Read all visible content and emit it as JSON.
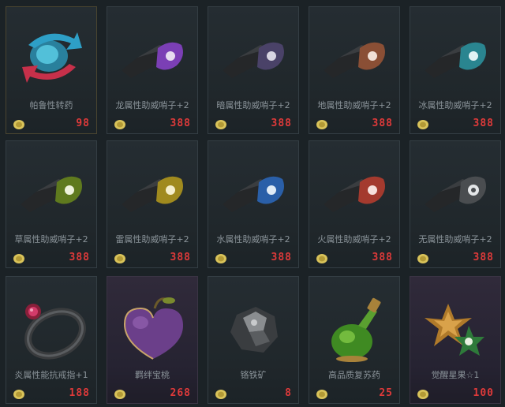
{
  "items": [
    {
      "name": "帕鲁性转药",
      "price": "98",
      "icon": "gender-swap-potion-icon"
    },
    {
      "name": "龙属性助威哨子+2",
      "price": "388",
      "icon": "dragon-whistle-icon",
      "color": "#7b3fb5"
    },
    {
      "name": "暗属性助威哨子+2",
      "price": "388",
      "icon": "dark-whistle-icon",
      "color": "#4a4268"
    },
    {
      "name": "地属性助威哨子+2",
      "price": "388",
      "icon": "ground-whistle-icon",
      "color": "#8a4f35"
    },
    {
      "name": "冰属性助威哨子+2",
      "price": "388",
      "icon": "ice-whistle-icon",
      "color": "#2a8590"
    },
    {
      "name": "草属性助威哨子+2",
      "price": "388",
      "icon": "grass-whistle-icon",
      "color": "#5f7a1e"
    },
    {
      "name": "雷属性助威哨子+2",
      "price": "388",
      "icon": "electric-whistle-icon",
      "color": "#a08a1e"
    },
    {
      "name": "水属性助威哨子+2",
      "price": "388",
      "icon": "water-whistle-icon",
      "color": "#2a5fa8"
    },
    {
      "name": "火属性助威哨子+2",
      "price": "388",
      "icon": "fire-whistle-icon",
      "color": "#a43a2e"
    },
    {
      "name": "无属性助威哨子+2",
      "price": "388",
      "icon": "neutral-whistle-icon",
      "color": "#4a4d50"
    },
    {
      "name": "炎属性能抗戒指+1",
      "price": "188",
      "icon": "fire-resistance-ring-icon"
    },
    {
      "name": "羁绊宝桃",
      "price": "268",
      "icon": "bond-peach-icon"
    },
    {
      "name": "铬铁矿",
      "price": "8",
      "icon": "chromite-ore-icon"
    },
    {
      "name": "高品质复苏药",
      "price": "25",
      "icon": "revival-potion-icon"
    },
    {
      "name": "觉醒星果☆1",
      "price": "100",
      "icon": "awakening-star-fruit-icon"
    }
  ],
  "colors": {
    "price": "#e03a3a",
    "name": "#8b949a",
    "coin": "#d9c35a"
  }
}
